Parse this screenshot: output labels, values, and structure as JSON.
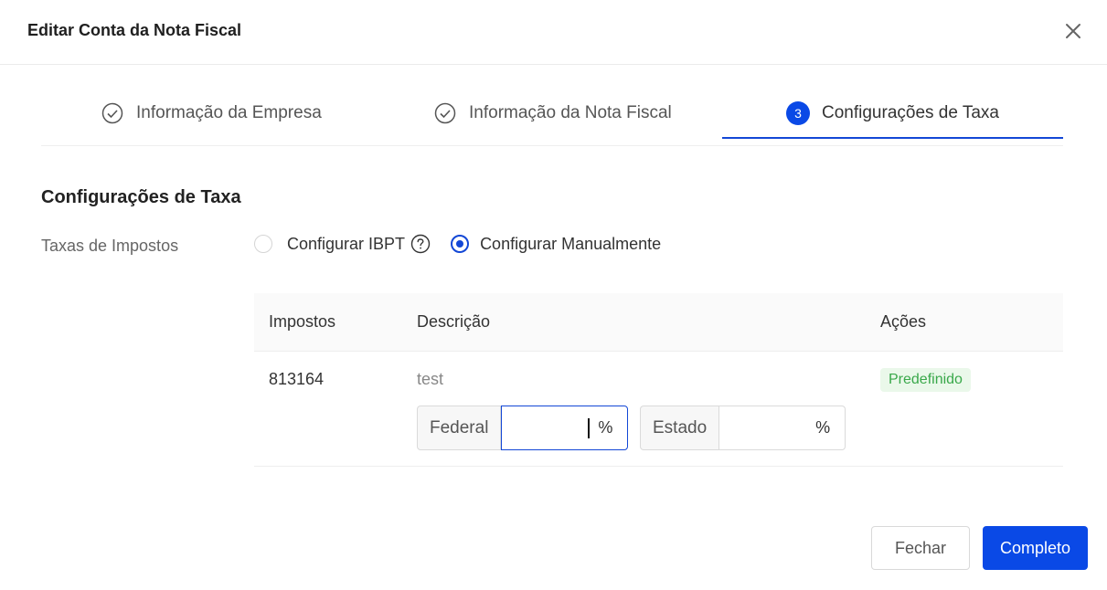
{
  "dialog": {
    "title": "Editar Conta da Nota Fiscal"
  },
  "steps": [
    {
      "label": "Informação da Empresa",
      "status": "done"
    },
    {
      "label": "Informação da Nota Fiscal",
      "status": "done"
    },
    {
      "label": "Configurações de Taxa",
      "status": "active",
      "number": "3"
    }
  ],
  "section": {
    "title": "Configurações de Taxa",
    "field_label": "Taxas de Impostos",
    "radio_ibpt": "Configurar IBPT",
    "radio_manual": "Configurar Manualmente",
    "selected": "manual"
  },
  "table": {
    "headers": {
      "taxes": "Impostos",
      "description": "Descrição",
      "actions": "Ações"
    },
    "rows": [
      {
        "tax": "813164",
        "description": "test",
        "badge": "Predefinido",
        "federal_label": "Federal",
        "federal_value": "",
        "state_label": "Estado",
        "state_value": "",
        "unit": "%"
      }
    ]
  },
  "buttons": {
    "close": "Fechar",
    "complete": "Completo"
  },
  "colors": {
    "primary": "#0a49e6",
    "badge_bg": "#eaf8ea",
    "badge_text": "#39a84a"
  }
}
